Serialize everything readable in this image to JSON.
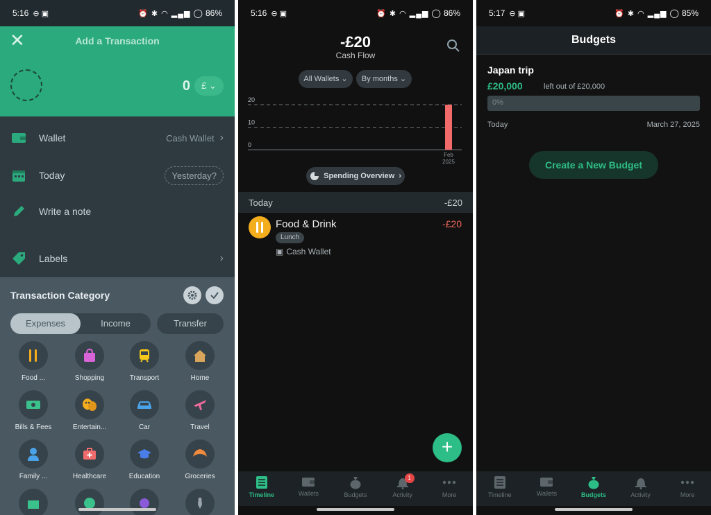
{
  "screens": {
    "add_transaction": {
      "status": {
        "time": "5:16",
        "battery": "86%"
      },
      "title": "Add a Transaction",
      "amount": "0",
      "currency": "£",
      "wallet": {
        "label": "Wallet",
        "value": "Cash Wallet"
      },
      "date": {
        "label": "Today",
        "alt": "Yesterday?"
      },
      "note": {
        "placeholder": "Write a note"
      },
      "labels": {
        "label": "Labels"
      },
      "category": {
        "title": "Transaction Category",
        "tabs": [
          "Expenses",
          "Income"
        ],
        "active_tab": "Expenses",
        "transfer": "Transfer",
        "items": [
          {
            "label": "Food ...",
            "icon": "fork-knife-icon",
            "color": "#f4ad1c"
          },
          {
            "label": "Shopping",
            "icon": "shopping-bag-icon",
            "color": "#d864d8"
          },
          {
            "label": "Transport",
            "icon": "train-icon",
            "color": "#f4c91c"
          },
          {
            "label": "Home",
            "icon": "house-icon",
            "color": "#d9a55b"
          },
          {
            "label": "Bills & Fees",
            "icon": "banknote-icon",
            "color": "#3bc28c"
          },
          {
            "label": "Entertain...",
            "icon": "theater-masks-icon",
            "color": "#f4ad1c"
          },
          {
            "label": "Car",
            "icon": "car-icon",
            "color": "#4aa3e8"
          },
          {
            "label": "Travel",
            "icon": "airplane-icon",
            "color": "#f06b9b"
          },
          {
            "label": "Family ...",
            "icon": "person-icon",
            "color": "#4aa3e8"
          },
          {
            "label": "Healthcare",
            "icon": "medical-kit-icon",
            "color": "#f06b6b"
          },
          {
            "label": "Education",
            "icon": "graduation-cap-icon",
            "color": "#4a7de8"
          },
          {
            "label": "Groceries",
            "icon": "croissant-icon",
            "color": "#f08a3c"
          }
        ]
      }
    },
    "timeline": {
      "status": {
        "time": "5:16",
        "battery": "86%"
      },
      "cash_flow_amount": "-£20",
      "cash_flow_label": "Cash Flow",
      "filter_wallets": "All Wallets",
      "filter_period": "By months",
      "spending_overview": "Spending Overview",
      "day_label": "Today",
      "day_total": "-£20",
      "transaction": {
        "category": "Food & Drink",
        "amount": "-£20",
        "tag": "Lunch",
        "wallet": "Cash Wallet"
      }
    },
    "budgets": {
      "status": {
        "time": "5:17",
        "battery": "85%"
      },
      "title": "Budgets",
      "budget": {
        "name": "Japan trip",
        "remaining": "£20,000",
        "left_text": "left out of £20,000",
        "progress_label": "0%",
        "progress": 0,
        "start": "Today",
        "end": "March 27, 2025"
      },
      "create_label": "Create a New Budget"
    }
  },
  "nav": {
    "items": [
      "Timeline",
      "Wallets",
      "Budgets",
      "Activity",
      "More"
    ],
    "activity_badge": "1"
  },
  "chart_data": {
    "type": "bar",
    "categories": [
      "Feb\n2025"
    ],
    "x_tick_line1": "Feb",
    "x_tick_line2": "2025",
    "values": [
      20
    ],
    "ylim": [
      0,
      20
    ],
    "y_ticks": [
      "20",
      "10",
      "0"
    ],
    "bar_color": "#f26a6a",
    "grid": true
  },
  "colors": {
    "accent": "#2dbd86",
    "header_green": "#2bab7d",
    "expense_red": "#f0675b"
  }
}
